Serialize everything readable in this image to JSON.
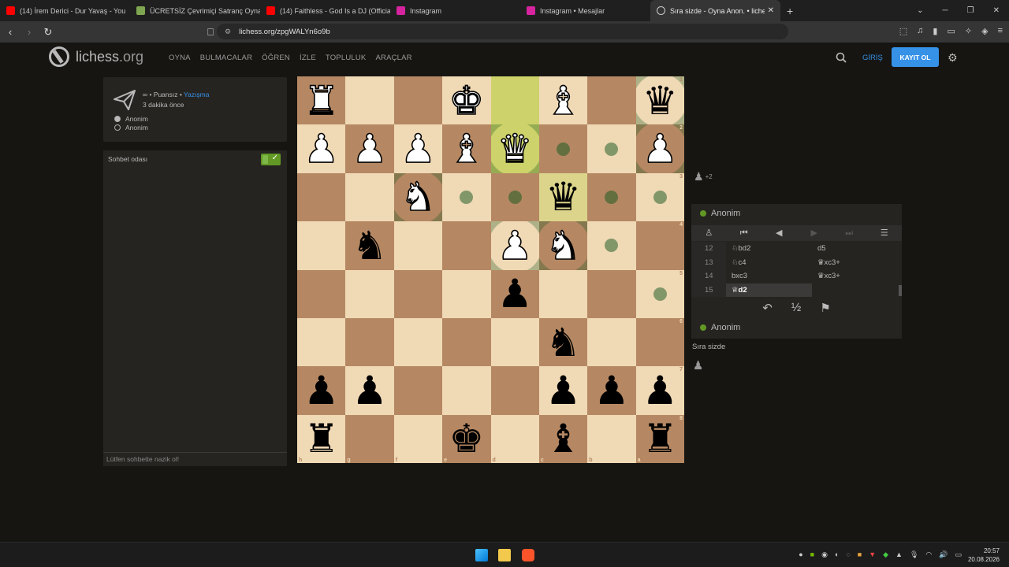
{
  "browser": {
    "tabs": [
      {
        "label": "(14) İrem Derici - Dur Yavaş - You",
        "icon": "youtube-icon",
        "color": "#ff0000"
      },
      {
        "label": "ÜCRETSİZ Çevrimiçi Satranç Oynayın",
        "icon": "chess-icon",
        "color": "#7fa650"
      },
      {
        "label": "(14) Faithless - God Is a DJ (Official V",
        "icon": "youtube-icon",
        "color": "#ff0000"
      },
      {
        "label": "Instagram",
        "icon": "instagram-icon",
        "color": "#d6249f"
      },
      {
        "label": "Instagram • Mesajlar",
        "icon": "instagram-icon",
        "color": "#d6249f"
      },
      {
        "label": "Sıra sizde - Oyna Anon. • liches",
        "icon": "lichess-icon",
        "color": "#cccccc",
        "active": true
      }
    ],
    "url": "lichess.org/zpgWALYn6o9b"
  },
  "header": {
    "logo": "lichess",
    "logo_tld": ".org",
    "nav": [
      "OYNA",
      "BULMACALAR",
      "ÖĞREN",
      "İZLE",
      "TOPLULUK",
      "ARAÇLAR"
    ],
    "login": "GİRİŞ",
    "signup": "KAYIT OL"
  },
  "game_info": {
    "speed_icon": "∞",
    "rated": "• Puansız •",
    "variant": "Yazışma",
    "time_ago": "3 dakika önce",
    "players": [
      "Anonim",
      "Anonim"
    ]
  },
  "chat": {
    "title": "Sohbet odası",
    "placeholder": "Lütfen sohbette nazik ol!"
  },
  "board": {
    "orientation": "black",
    "files": [
      "h",
      "g",
      "f",
      "e",
      "d",
      "c",
      "b",
      "a"
    ],
    "ranks": [
      "1",
      "2",
      "3",
      "4",
      "5",
      "6",
      "7",
      "8"
    ],
    "pieces": [
      {
        "sq": "h1",
        "p": "R",
        "c": "w"
      },
      {
        "sq": "e1",
        "p": "K",
        "c": "w"
      },
      {
        "sq": "c1",
        "p": "B",
        "c": "w"
      },
      {
        "sq": "a1",
        "p": "Q",
        "c": "b"
      },
      {
        "sq": "h2",
        "p": "P",
        "c": "w"
      },
      {
        "sq": "g2",
        "p": "P",
        "c": "w"
      },
      {
        "sq": "f2",
        "p": "P",
        "c": "w"
      },
      {
        "sq": "e2",
        "p": "B",
        "c": "w"
      },
      {
        "sq": "d2",
        "p": "Q",
        "c": "w"
      },
      {
        "sq": "a2",
        "p": "P",
        "c": "w"
      },
      {
        "sq": "f3",
        "p": "N",
        "c": "w"
      },
      {
        "sq": "c3",
        "p": "Q",
        "c": "b"
      },
      {
        "sq": "g4",
        "p": "N",
        "c": "b"
      },
      {
        "sq": "d4",
        "p": "P",
        "c": "w"
      },
      {
        "sq": "c4",
        "p": "N",
        "c": "w"
      },
      {
        "sq": "d5",
        "p": "P",
        "c": "b"
      },
      {
        "sq": "c6",
        "p": "N",
        "c": "b"
      },
      {
        "sq": "h7",
        "p": "P",
        "c": "b"
      },
      {
        "sq": "g7",
        "p": "P",
        "c": "b"
      },
      {
        "sq": "c7",
        "p": "P",
        "c": "b"
      },
      {
        "sq": "b7",
        "p": "P",
        "c": "b"
      },
      {
        "sq": "a7",
        "p": "P",
        "c": "b"
      },
      {
        "sq": "h8",
        "p": "R",
        "c": "b"
      },
      {
        "sq": "e8",
        "p": "K",
        "c": "b"
      },
      {
        "sq": "c8",
        "p": "B",
        "c": "b"
      },
      {
        "sq": "a8",
        "p": "R",
        "c": "b"
      }
    ],
    "last_move": [
      "d1",
      "d2"
    ],
    "selected": "c3",
    "dests": [
      "c2",
      "b2",
      "e3",
      "d3",
      "b3",
      "a3",
      "b4",
      "a5"
    ],
    "captures": [
      "d2",
      "f3",
      "d4",
      "c4",
      "a1",
      "a2"
    ],
    "colors": {
      "light": "#f0d9b5",
      "dark": "#b58863",
      "last_move": "#cdd26a"
    }
  },
  "material": {
    "piece": "pawn-icon",
    "diff": "+2"
  },
  "moves_panel": {
    "opponent": "Anonim",
    "player": "Anonim",
    "moves": [
      {
        "n": "12",
        "w": "♘bd2",
        "b": "d5"
      },
      {
        "n": "13",
        "w": "♘c4",
        "b": "♛xc3+"
      },
      {
        "n": "14",
        "w": "bxc3",
        "b": "♛xc3+"
      },
      {
        "n": "15",
        "w": "♕d2",
        "b": ""
      }
    ],
    "your_turn": "Sıra sizde"
  },
  "taskbar": {
    "time": "20:57",
    "date": "20.08.2026"
  }
}
